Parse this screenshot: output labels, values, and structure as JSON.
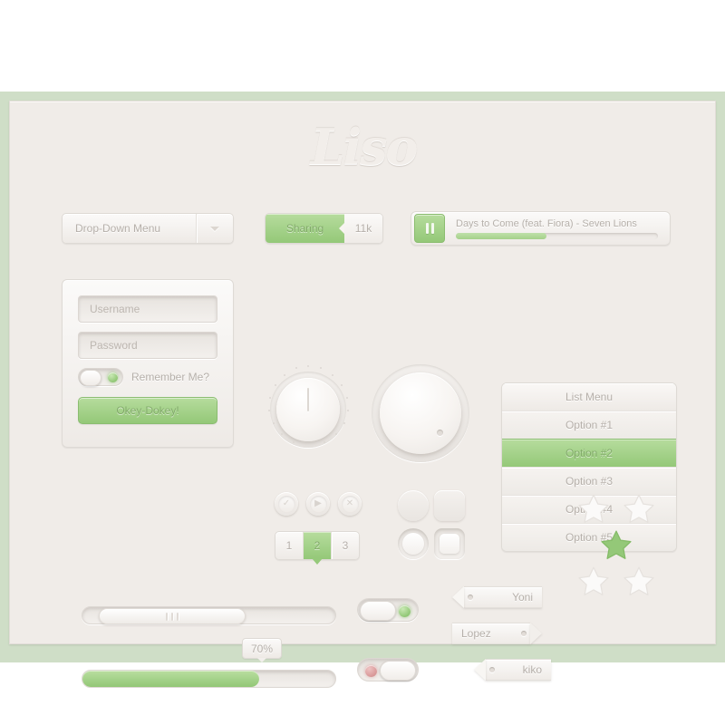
{
  "theme": {
    "accent_green": "#94c878",
    "panel_bg": "#f0ece8",
    "frame_green": "#cfdec7",
    "text_muted": "#b6b0aa",
    "led_red": "#cf8585"
  },
  "logo": {
    "text": "Liso"
  },
  "dropdown": {
    "label": "Drop-Down Menu",
    "arrow_icon": "chevron-down-icon"
  },
  "share": {
    "label": "Sharing",
    "count": "11k"
  },
  "player": {
    "play_pause_icon": "pause-icon",
    "track_title": "Days to Come (feat. Fiora) - Seven Lions",
    "progress_percent": 45
  },
  "login": {
    "username_placeholder": "Username",
    "password_placeholder": "Password",
    "remember_label": "Remember Me?",
    "remember_on": true,
    "submit_label": "Okey-Dokey!"
  },
  "knobs": [
    {
      "name": "knob-ticked",
      "value_angle": 0,
      "indicator": "line"
    },
    {
      "name": "knob-plain",
      "value_angle": 135,
      "indicator": "dot"
    }
  ],
  "icon_buttons": [
    {
      "name": "confirm-button",
      "icon": "check-icon",
      "glyph": "✓"
    },
    {
      "name": "play-button",
      "icon": "play-icon",
      "glyph": "▶"
    },
    {
      "name": "close-button",
      "icon": "close-icon",
      "glyph": "✕"
    }
  ],
  "segmented": {
    "options": [
      "1",
      "2",
      "3"
    ],
    "selected_index": 1
  },
  "shape_swatches": [
    {
      "name": "radio-unchecked",
      "shape": "circle",
      "state": "flat"
    },
    {
      "name": "checkbox-unchecked",
      "shape": "square",
      "state": "flat"
    },
    {
      "name": "radio-checked",
      "shape": "circle",
      "state": "inset"
    },
    {
      "name": "checkbox-checked",
      "shape": "square",
      "state": "inset"
    }
  ],
  "list_menu": {
    "header": "List Menu",
    "items": [
      {
        "label": "Option #1",
        "selected": false
      },
      {
        "label": "Option #2",
        "selected": true
      },
      {
        "label": "Option #3",
        "selected": false
      },
      {
        "label": "Option #4",
        "selected": false
      },
      {
        "label": "Option #5",
        "selected": false
      }
    ]
  },
  "scrollbar": {
    "handle_grip_icon": "grip-lines-icon",
    "handle_position_percent": 6,
    "handle_width_percent": 57
  },
  "progress": {
    "value": 70,
    "tooltip_label": "70%"
  },
  "toggles": [
    {
      "name": "toggle-on",
      "state": "on",
      "led": "green"
    },
    {
      "name": "toggle-off",
      "state": "off",
      "led": "red"
    }
  ],
  "tags": [
    {
      "label": "Yoni",
      "direction": "left"
    },
    {
      "label": "Lopez",
      "direction": "right"
    },
    {
      "label": "kiko",
      "direction": "left"
    }
  ],
  "stars": {
    "rating_label": "",
    "items": [
      {
        "position": "top-left",
        "filled": false
      },
      {
        "position": "top-right",
        "filled": false
      },
      {
        "position": "center",
        "filled": true
      },
      {
        "position": "bottom-left",
        "filled": false
      },
      {
        "position": "bottom-right",
        "filled": false
      }
    ]
  }
}
